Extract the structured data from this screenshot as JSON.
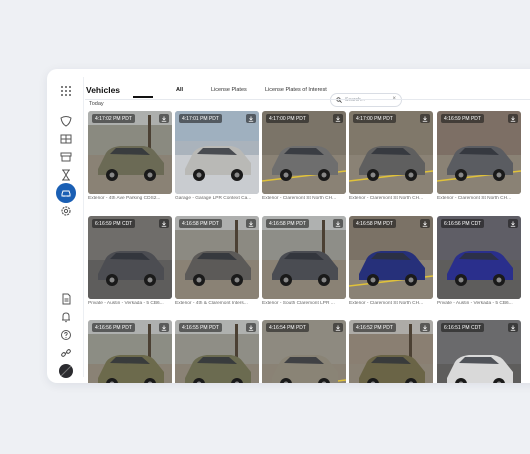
{
  "header": {
    "title": "Vehicles",
    "tabs": [
      {
        "label": "All",
        "active": true
      },
      {
        "label": "License Plates",
        "active": false
      },
      {
        "label": "License Plates of Interest",
        "active": false
      }
    ],
    "search": {
      "placeholder": "Search..."
    }
  },
  "section_label": "Today",
  "sidebar": {
    "top": [
      "apps-grid-icon",
      "shield-icon",
      "floorplan-icon",
      "archive-icon",
      "hourglass-icon",
      "vehicle-icon",
      "settings-gear-icon"
    ],
    "bottom": [
      "document-icon",
      "bell-icon",
      "help-icon",
      "link-icon",
      "avatar"
    ],
    "active": "vehicle-icon",
    "accent": "#1a5fb4"
  },
  "cards": [
    {
      "time": "4:17:02 PM PDT",
      "caption": "Exterior - 4th Ave Parking CDS2...",
      "scene": "street",
      "car": "#6b6a55",
      "bg": "#8a8a80"
    },
    {
      "time": "4:17:01 PM PDT",
      "caption": "Garage - Garage LPR Context Ca...",
      "scene": "garage",
      "car": "#b9b9b6",
      "bg": "#aab3bc"
    },
    {
      "time": "4:17:00 PM PDT",
      "caption": "Exterior - Claremont St North CH...",
      "scene": "road",
      "car": "#6e6e6e",
      "bg": "#7b7468"
    },
    {
      "time": "4:17:00 PM PDT",
      "caption": "Exterior - Claremont St North CH...",
      "scene": "road",
      "car": "#5f5f5f",
      "bg": "#80786a"
    },
    {
      "time": "4:16:59 PM PDT",
      "caption": "Exterior - Claremont St North CH...",
      "scene": "road",
      "car": "#5a5c61",
      "bg": "#7d6f65"
    },
    {
      "time": "6:16:59 PM CDT",
      "caption": "Private - Austin - Verkada - 5 CB6...",
      "scene": "lot",
      "car": "#4c4d52",
      "bg": "#6f6d6a"
    },
    {
      "time": "4:16:58 PM PDT",
      "caption": "Exterior - 4th & Claremont Inters...",
      "scene": "street",
      "car": "#5c5a58",
      "bg": "#8c8a82"
    },
    {
      "time": "4:16:58 PM PDT",
      "caption": "Exterior - South Claremont LPR ...",
      "scene": "street",
      "car": "#4a4c52",
      "bg": "#8e8e88"
    },
    {
      "time": "4:16:58 PM PDT",
      "caption": "Exterior - Claremont St North CH...",
      "scene": "road",
      "car": "#26307a",
      "bg": "#7b7266"
    },
    {
      "time": "6:16:56 PM CDT",
      "caption": "Private - Austin - Verkada - 5 CB6...",
      "scene": "lot",
      "car": "#2a2f8c",
      "bg": "#5f5e66"
    },
    {
      "time": "4:16:56 PM PDT",
      "caption": "",
      "scene": "street",
      "car": "#6c6a4c",
      "bg": "#8c8d84"
    },
    {
      "time": "4:16:55 PM PDT",
      "caption": "",
      "scene": "street",
      "car": "#6b6b50",
      "bg": "#8f8e86"
    },
    {
      "time": "4:16:54 PM PDT",
      "caption": "",
      "scene": "road",
      "car": "#8a8476",
      "bg": "#8e8a80"
    },
    {
      "time": "4:16:52 PM PDT",
      "caption": "",
      "scene": "street",
      "car": "#6a6446",
      "bg": "#8a7f72"
    },
    {
      "time": "6:16:51 PM CDT",
      "caption": "",
      "scene": "lot",
      "car": "#d9d9d9",
      "bg": "#6a6a6c"
    }
  ]
}
